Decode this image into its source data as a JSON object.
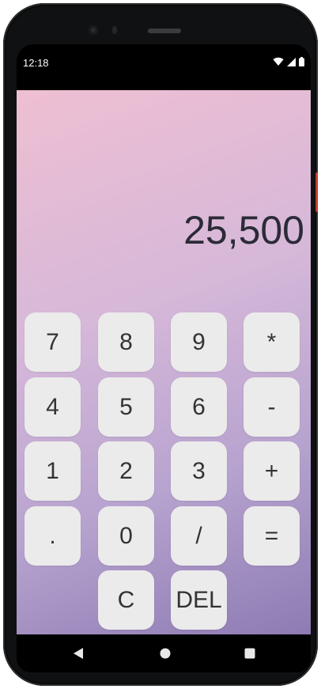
{
  "status_bar": {
    "time": "12:18",
    "icons": [
      "wifi-icon",
      "signal-icon",
      "battery-icon"
    ]
  },
  "display": {
    "value": "25,500"
  },
  "keypad": {
    "rows": [
      [
        "7",
        "8",
        "9",
        "*"
      ],
      [
        "4",
        "5",
        "6",
        "-"
      ],
      [
        "1",
        "2",
        "3",
        "+"
      ],
      [
        ".",
        "0",
        "/",
        "="
      ],
      [
        "C",
        "DEL"
      ]
    ]
  },
  "nav_bar": {
    "buttons": [
      "back-icon",
      "home-icon",
      "recents-icon"
    ]
  },
  "colors": {
    "gradient_top": "#efbfd2",
    "gradient_bottom": "#8d7bb3",
    "key_background": "#ebebeb",
    "display_text": "#2b2b38"
  }
}
